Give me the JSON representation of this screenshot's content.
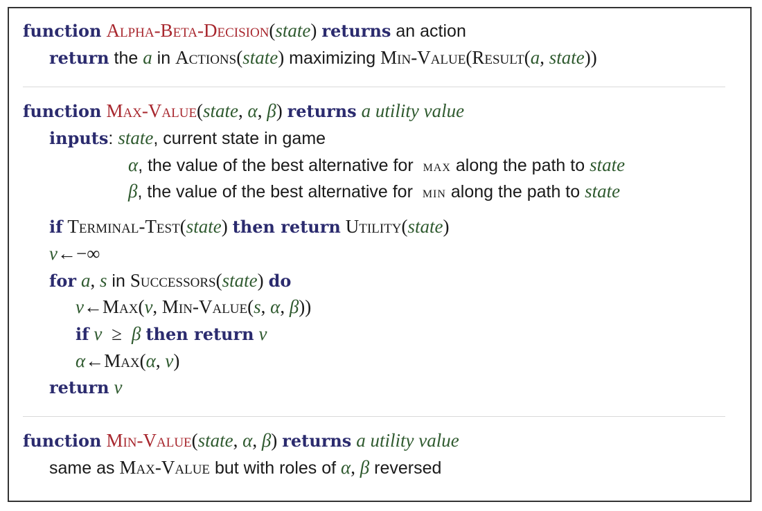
{
  "kw": {
    "function": "function",
    "returns": "returns",
    "return": "return",
    "inputs": "inputs",
    "if": "if",
    "then": "then",
    "then_return": "then return",
    "for": "for",
    "do": "do"
  },
  "names": {
    "alpha_beta_decision": "Alpha-Beta-Decision",
    "max_value": "Max-Value",
    "min_value": "Min-Value",
    "actions": "Actions",
    "result": "Result",
    "terminal_test": "Terminal-Test",
    "utility": "Utility",
    "successors": "Successors",
    "max": "Max",
    "max_small": "max",
    "min_small": "min"
  },
  "vars": {
    "state": "state",
    "a": "a",
    "s": "s",
    "v": "v",
    "alpha": "α",
    "beta": "β",
    "a_utility_value": "a utility value"
  },
  "text": {
    "an_action": "an action",
    "the": "the",
    "in": "in",
    "maximizing": "maximizing",
    "current_state_in_game": "current state in game",
    "alpha_desc": ", the value of the best alternative for",
    "along_path": "along the path to",
    "same_as": "same as",
    "but_with_roles": "but with roles of",
    "reversed": "reversed"
  },
  "sym": {
    "assign": "←",
    "neg_inf": "−∞",
    "geq": "≥"
  }
}
